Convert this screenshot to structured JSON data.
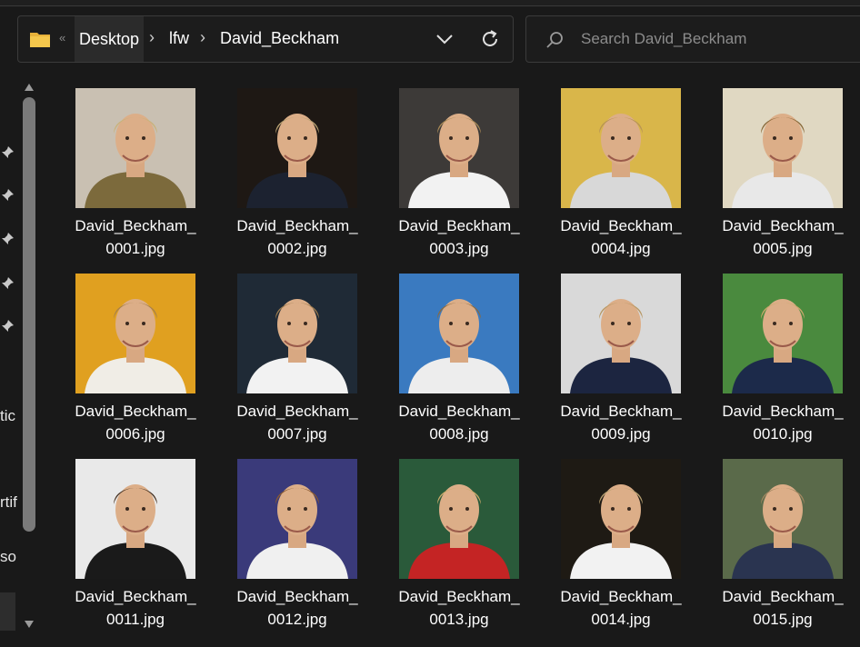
{
  "address": {
    "overflow_glyph": "«",
    "crumbs": [
      "Desktop",
      "lfw",
      "David_Beckham"
    ],
    "separator": "›",
    "dropdown_icon": "chevron-down-icon",
    "refresh_icon": "refresh-icon"
  },
  "search": {
    "placeholder": "Search David_Beckham",
    "icon": "search-icon"
  },
  "nav": {
    "partial_items": [
      "tic",
      "rtif",
      "so"
    ],
    "pinned_icon": "pin-icon"
  },
  "files": [
    {
      "line1": "David_Beckham_",
      "line2": "0001.jpg",
      "bg": "#c9c0b2",
      "shirt": "#7c6a3c",
      "hair": "#c9b27a"
    },
    {
      "line1": "David_Beckham_",
      "line2": "0002.jpg",
      "bg": "#1e1814",
      "shirt": "#1c2230",
      "hair": "#b8a071"
    },
    {
      "line1": "David_Beckham_",
      "line2": "0003.jpg",
      "bg": "#3d3a38",
      "shirt": "#f2f2f2",
      "hair": "#a88956"
    },
    {
      "line1": "David_Beckham_",
      "line2": "0004.jpg",
      "bg": "#d9b64a",
      "shirt": "#d8d8d8",
      "hair": "#b89455"
    },
    {
      "line1": "David_Beckham_",
      "line2": "0005.jpg",
      "bg": "#e0d8c2",
      "shirt": "#e8e8e8",
      "hair": "#8a6a3a"
    },
    {
      "line1": "David_Beckham_",
      "line2": "0006.jpg",
      "bg": "#e0a020",
      "shirt": "#f0ede6",
      "hair": "#a8814a"
    },
    {
      "line1": "David_Beckham_",
      "line2": "0007.jpg",
      "bg": "#1f2a36",
      "shirt": "#f2f2f2",
      "hair": "#9a7a4e"
    },
    {
      "line1": "David_Beckham_",
      "line2": "0008.jpg",
      "bg": "#3a7ac0",
      "shirt": "#ededed",
      "hair": "#8a6a40"
    },
    {
      "line1": "David_Beckham_",
      "line2": "0009.jpg",
      "bg": "#d9d9d9",
      "shirt": "#1c2540",
      "hair": "#b89864"
    },
    {
      "line1": "David_Beckham_",
      "line2": "0010.jpg",
      "bg": "#4a8a3e",
      "shirt": "#1c2a4a",
      "hair": "#caa86c"
    },
    {
      "line1": "David_Beckham_",
      "line2": "0011.jpg",
      "bg": "#e9e9e9",
      "shirt": "#1a1a1a",
      "hair": "#4a3626"
    },
    {
      "line1": "David_Beckham_",
      "line2": "0012.jpg",
      "bg": "#3a3a7a",
      "shirt": "#f0f0f0",
      "hair": "#8a5a30"
    },
    {
      "line1": "David_Beckham_",
      "line2": "0013.jpg",
      "bg": "#2a5a3a",
      "shirt": "#c42424",
      "hair": "#c9aa6a"
    },
    {
      "line1": "David_Beckham_",
      "line2": "0014.jpg",
      "bg": "#1e1a14",
      "shirt": "#f2f2f2",
      "hair": "#b8a070"
    },
    {
      "line1": "David_Beckham_",
      "line2": "0015.jpg",
      "bg": "#5a6a4a",
      "shirt": "#2a3450",
      "hair": "#a08660"
    }
  ]
}
